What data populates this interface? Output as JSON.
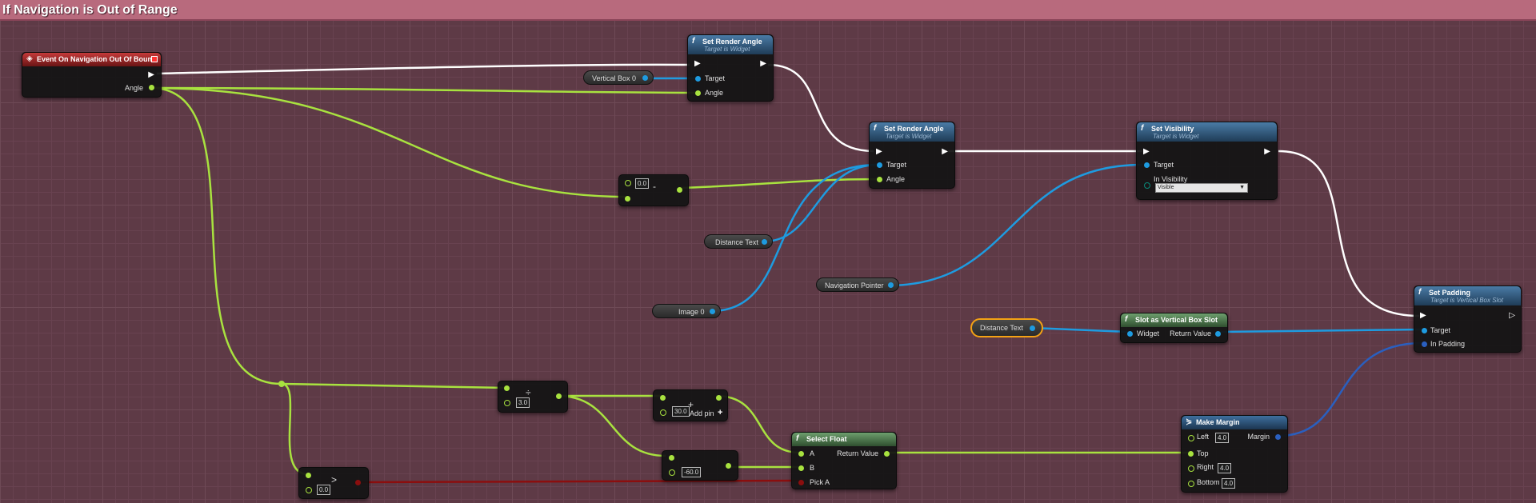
{
  "graph": {
    "comment_title": "If Navigation is Out of Range"
  },
  "nodes": {
    "event": {
      "title": "Event On Navigation Out Of Bound",
      "angle_pin": "Angle"
    },
    "set_render_angle_1": {
      "title": "Set Render Angle",
      "subtitle": "Target is Widget",
      "target_pin": "Target",
      "angle_pin": "Angle"
    },
    "set_render_angle_2": {
      "title": "Set Render Angle",
      "subtitle": "Target is Widget",
      "target_pin": "Target",
      "angle_pin": "Angle"
    },
    "set_visibility": {
      "title": "Set Visibility",
      "subtitle": "Target is Widget",
      "target_pin": "Target",
      "visibility_pin": "In Visibility",
      "visibility_value": "Visible"
    },
    "set_padding": {
      "title": "Set Padding",
      "subtitle": "Target is Vertical Box Slot",
      "target_pin": "Target",
      "padding_pin": "In Padding"
    },
    "slot_as_vbox": {
      "title": "Slot as Vertical Box Slot",
      "widget_pin": "Widget",
      "return_pin": "Return Value"
    },
    "make_margin": {
      "title": "Make Margin",
      "left_pin": "Left",
      "left_value": "4.0",
      "top_pin": "Top",
      "right_pin": "Right",
      "right_value": "4.0",
      "bottom_pin": "Bottom",
      "bottom_value": "4.0",
      "margin_pin": "Margin"
    },
    "select_float": {
      "title": "Select Float",
      "a_pin": "A",
      "b_pin": "B",
      "pick_pin": "Pick A",
      "return_pin": "Return Value"
    },
    "subtract_node": {
      "value": "0.0",
      "operator": "-"
    },
    "divide_node": {
      "value": "3.0",
      "operator": "÷"
    },
    "add_node": {
      "value": "30.0",
      "add_pin_label": "Add pin",
      "add_icon": "+",
      "operator": "+"
    },
    "const_node": {
      "value": "-60.0"
    },
    "compare_node": {
      "value": "0.0",
      "operator": ">"
    }
  },
  "variables": {
    "vertical_box": "Vertical Box 0",
    "distance_text_1": "Distance Text",
    "image": "Image 0",
    "navigation_pointer": "Navigation Pointer",
    "distance_text_2": "Distance Text"
  },
  "colors": {
    "exec": "#ffffff",
    "float": "#a8e23f",
    "object": "#1e9be0",
    "bool": "#8b0e0e",
    "struct": "#2a5fbf",
    "graph_bg": "#5e3a46",
    "comment": "#b86a7d",
    "selection": "#f4a214"
  }
}
